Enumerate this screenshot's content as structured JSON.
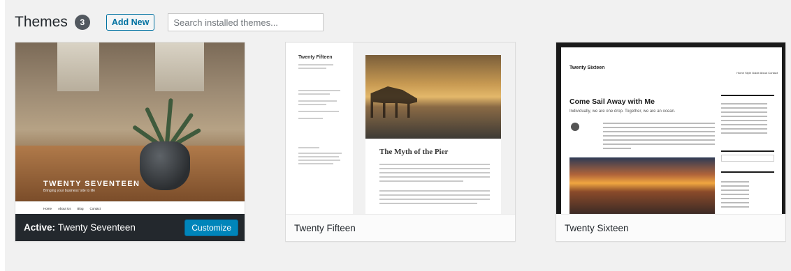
{
  "header": {
    "title": "Themes",
    "count": "3",
    "add_new": "Add New",
    "search_placeholder": "Search installed themes..."
  },
  "themes": [
    {
      "active_label": "Active:",
      "name": "Twenty Seventeen",
      "customize": "Customize",
      "preview": {
        "site_title": "TWENTY SEVENTEEN",
        "tagline": "Bringing your business' site to life",
        "nav": [
          "Home",
          "About Us",
          "Blog",
          "Contact"
        ]
      }
    },
    {
      "name": "Twenty Fifteen",
      "preview": {
        "site_title": "Twenty Fifteen",
        "post_title": "The Myth of the Pier"
      }
    },
    {
      "name": "Twenty Sixteen",
      "preview": {
        "site_title": "Twenty Sixteen",
        "nav": "Home  Style Guide  About  Contact",
        "headline": "Come Sail Away with Me",
        "subhead": "Individually, we are one drop. Together, we are an ocean."
      }
    }
  ],
  "colors": {
    "accent": "#0085ba",
    "active_bar": "#23282d",
    "page_bg": "#f1f1f1"
  }
}
